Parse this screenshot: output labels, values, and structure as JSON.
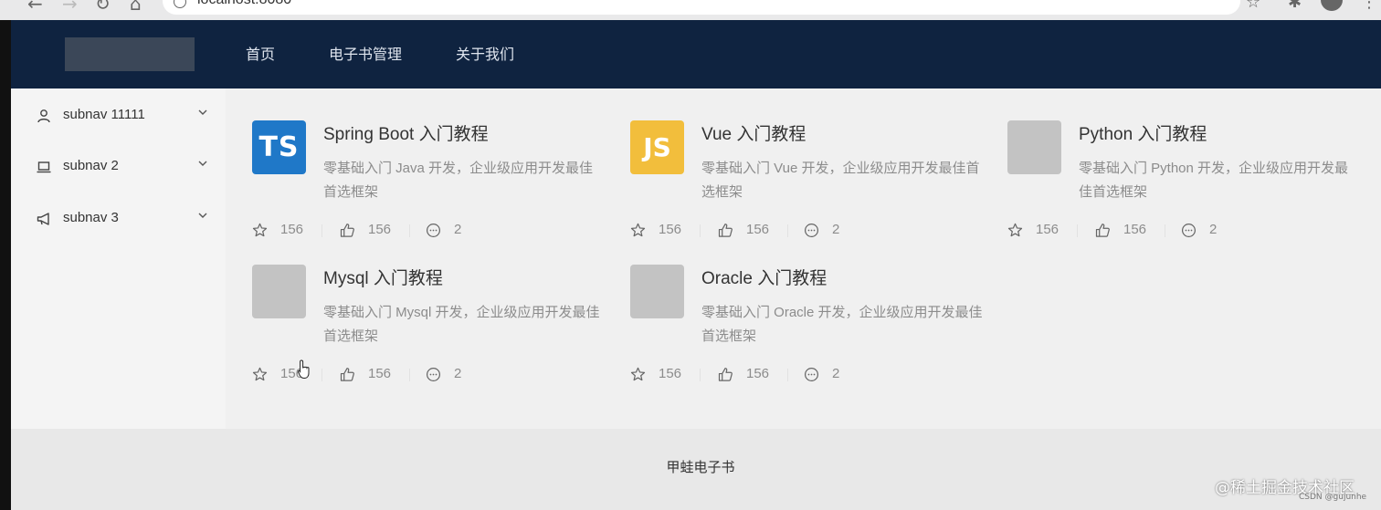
{
  "browser": {
    "url": "localhost:8080"
  },
  "header": {
    "menu": [
      {
        "label": "首页"
      },
      {
        "label": "电子书管理"
      },
      {
        "label": "关于我们"
      }
    ]
  },
  "sidebar": {
    "items": [
      {
        "label": "subnav 11111",
        "icon": "user-icon"
      },
      {
        "label": "subnav 2",
        "icon": "laptop-icon"
      },
      {
        "label": "subnav 3",
        "icon": "megaphone-icon"
      }
    ]
  },
  "books": [
    {
      "title": "Spring Boot 入门教程",
      "desc": "零基础入门 Java 开发，企业级应用开发最佳首选框架",
      "avatar": "TS",
      "stars": "156",
      "likes": "156",
      "comments": "2"
    },
    {
      "title": "Vue 入门教程",
      "desc": "零基础入门 Vue 开发，企业级应用开发最佳首选框架",
      "avatar": "JS",
      "stars": "156",
      "likes": "156",
      "comments": "2"
    },
    {
      "title": "Python 入门教程",
      "desc": "零基础入门 Python 开发，企业级应用开发最佳首选框架",
      "avatar": "",
      "stars": "156",
      "likes": "156",
      "comments": "2"
    },
    {
      "title": "Mysql 入门教程",
      "desc": "零基础入门 Mysql 开发，企业级应用开发最佳首选框架",
      "avatar": "",
      "stars": "156",
      "likes": "156",
      "comments": "2"
    },
    {
      "title": "Oracle 入门教程",
      "desc": "零基础入门 Oracle 开发，企业级应用开发最佳首选框架",
      "avatar": "",
      "stars": "156",
      "likes": "156",
      "comments": "2"
    }
  ],
  "footer": {
    "text": "甲蛙电子书"
  },
  "watermark": {
    "main": "@稀土掘金技术社区",
    "sub": "CSDN @gujunhe"
  }
}
